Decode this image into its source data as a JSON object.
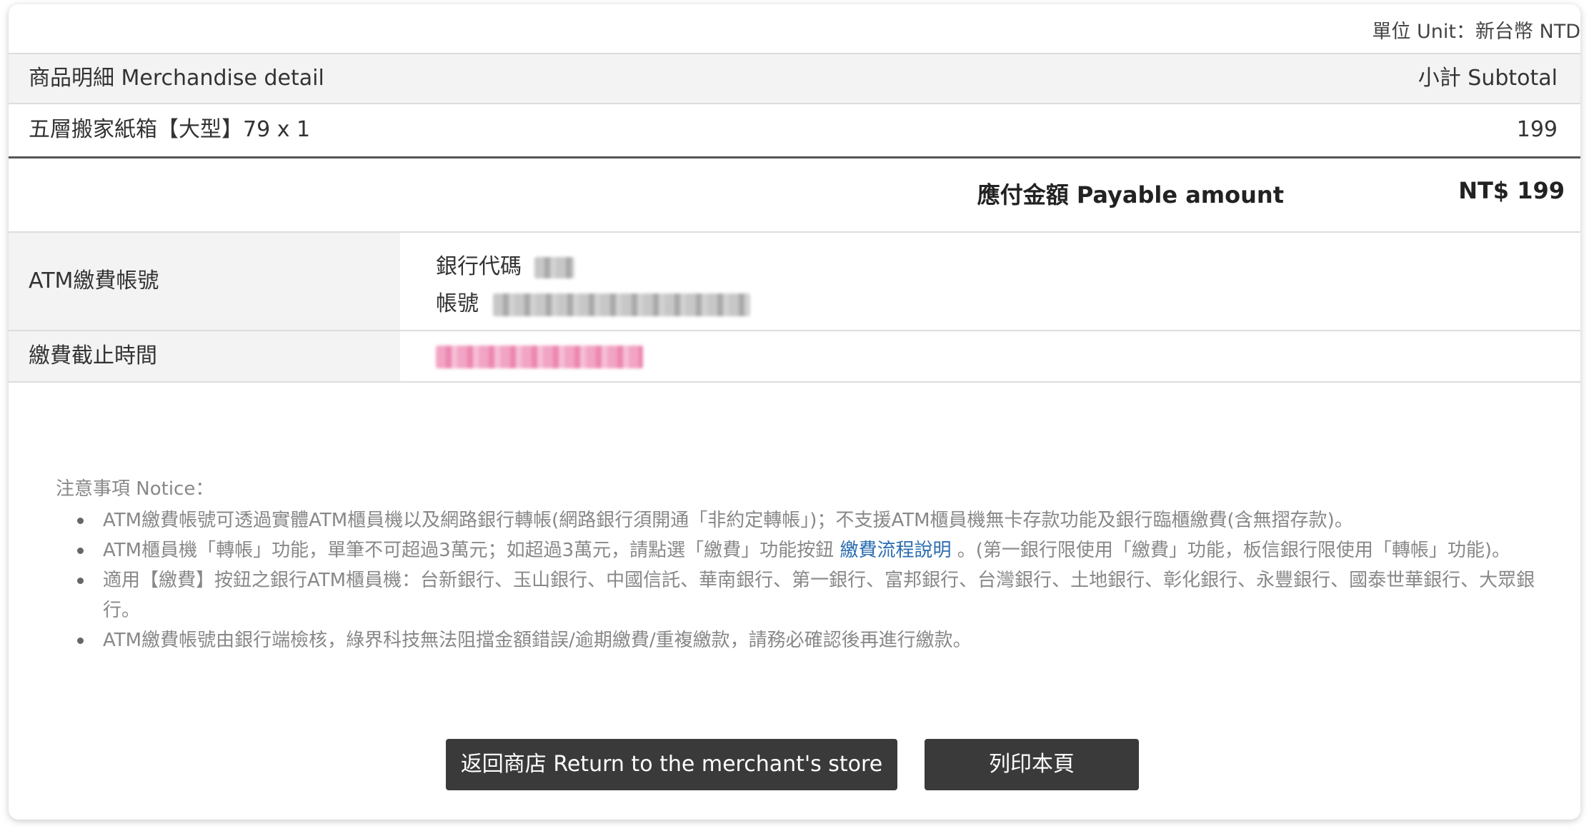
{
  "unit_label": "單位 Unit：新台幣 NTD",
  "table": {
    "header_item": "商品明細 Merchandise detail",
    "header_subtotal": "小計 Subtotal",
    "item_name": "五層搬家紙箱【大型】79 x 1",
    "item_subtotal": "199"
  },
  "payable": {
    "label": "應付金額 Payable amount",
    "value": "NT$ 199"
  },
  "atm": {
    "label": "ATM繳費帳號",
    "bank_code_label": "銀行代碼",
    "account_label": "帳號"
  },
  "deadline": {
    "label": "繳費截止時間"
  },
  "notice": {
    "title": "注意事項 Notice：",
    "item1": "ATM繳費帳號可透過實體ATM櫃員機以及網路銀行轉帳(網路銀行須開通「非約定轉帳」)；不支援ATM櫃員機無卡存款功能及銀行臨櫃繳費(含無摺存款)。",
    "item2_before": "ATM櫃員機「轉帳」功能，單筆不可超過3萬元；如超過3萬元，請點選「繳費」功能按鈕 ",
    "item2_link": "繳費流程說明",
    "item2_after": " 。(第一銀行限使用「繳費」功能，板信銀行限使用「轉帳」功能)。",
    "item3": "適用【繳費】按鈕之銀行ATM櫃員機：台新銀行、玉山銀行、中國信託、華南銀行、第一銀行、富邦銀行、台灣銀行、土地銀行、彰化銀行、永豐銀行、國泰世華銀行、大眾銀行。",
    "item4": "ATM繳費帳號由銀行端檢核，綠界科技無法阻擋金額錯誤/逾期繳費/重複繳款，請務必確認後再進行繳款。"
  },
  "buttons": {
    "return": "返回商店 Return to the merchant's store",
    "print": "列印本頁"
  }
}
